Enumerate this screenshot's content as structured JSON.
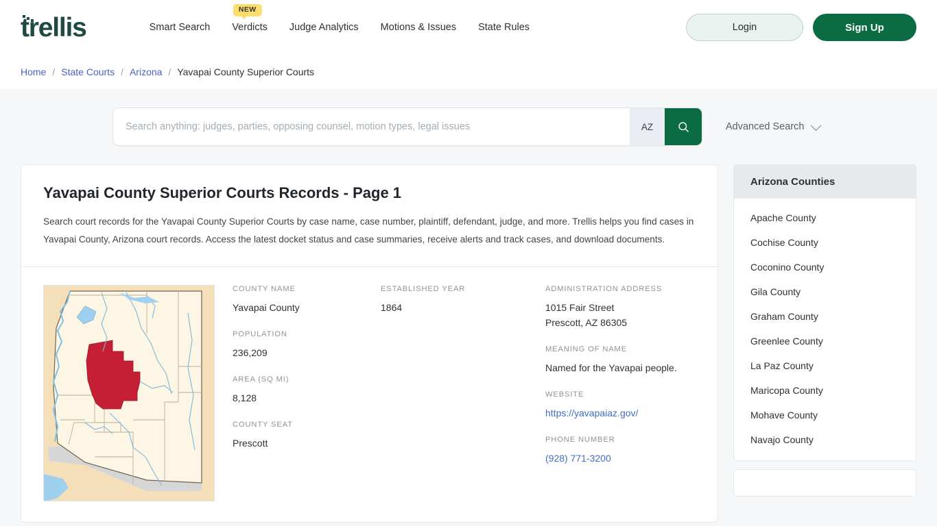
{
  "brand": {
    "name": "trellis"
  },
  "nav": {
    "items": [
      {
        "label": "Smart Search",
        "badge": null
      },
      {
        "label": "Verdicts",
        "badge": "NEW"
      },
      {
        "label": "Judge Analytics",
        "badge": null
      },
      {
        "label": "Motions & Issues",
        "badge": null
      },
      {
        "label": "State Rules",
        "badge": null
      }
    ]
  },
  "auth": {
    "login_label": "Login",
    "signup_label": "Sign Up"
  },
  "breadcrumb": {
    "items": [
      "Home",
      "State Courts",
      "Arizona"
    ],
    "current": "Yavapai County Superior Courts",
    "separator": "/"
  },
  "search": {
    "placeholder": "Search anything: judges, parties, opposing counsel, motion types, legal issues",
    "value": "",
    "state": "AZ",
    "advanced_label": "Advanced Search",
    "search_icon": "magnifier-icon",
    "chevron_icon": "chevron-down-icon"
  },
  "main": {
    "title": "Yavapai County Superior Courts Records - Page 1",
    "description": "Search court records for the Yavapai County Superior Courts by case name, case number, plaintiff, defendant, judge, and more. Trellis helps you find cases in Yavapai County, Arizona court records. Access the latest docket status and case summaries, receive alerts and track cases, and download documents.",
    "map_alt": "arizona-county-map",
    "fields": {
      "county_name": {
        "label": "COUNTY NAME",
        "value": "Yavapai County"
      },
      "population": {
        "label": "POPULATION",
        "value": "236,209"
      },
      "area": {
        "label": "AREA (SQ MI)",
        "value": "8,128"
      },
      "county_seat": {
        "label": "COUNTY SEAT",
        "value": "Prescott"
      },
      "established_year": {
        "label": "ESTABLISHED YEAR",
        "value": "1864"
      },
      "admin_address": {
        "label": "ADMINISTRATION ADDRESS",
        "line1": "1015 Fair Street",
        "line2": "Prescott, AZ 86305"
      },
      "meaning_of_name": {
        "label": "MEANING OF NAME",
        "value": "Named for the Yavapai people."
      },
      "website": {
        "label": "WEBSITE",
        "value": "https://yavapaiaz.gov/"
      },
      "phone": {
        "label": "PHONE NUMBER",
        "value": "(928) 771-3200"
      }
    }
  },
  "sidebar": {
    "title": "Arizona Counties",
    "counties": [
      "Apache County",
      "Cochise County",
      "Coconino County",
      "Gila County",
      "Graham County",
      "Greenlee County",
      "La Paz County",
      "Maricopa County",
      "Mohave County",
      "Navajo County"
    ]
  },
  "colors": {
    "brand_green": "#0b6b43",
    "logo_teal": "#1f4a43",
    "link_blue": "#3f6cc4",
    "crumb_blue": "#4c5fc7",
    "badge_yellow": "#fbdd72",
    "map_highlight": "#c41f35"
  }
}
